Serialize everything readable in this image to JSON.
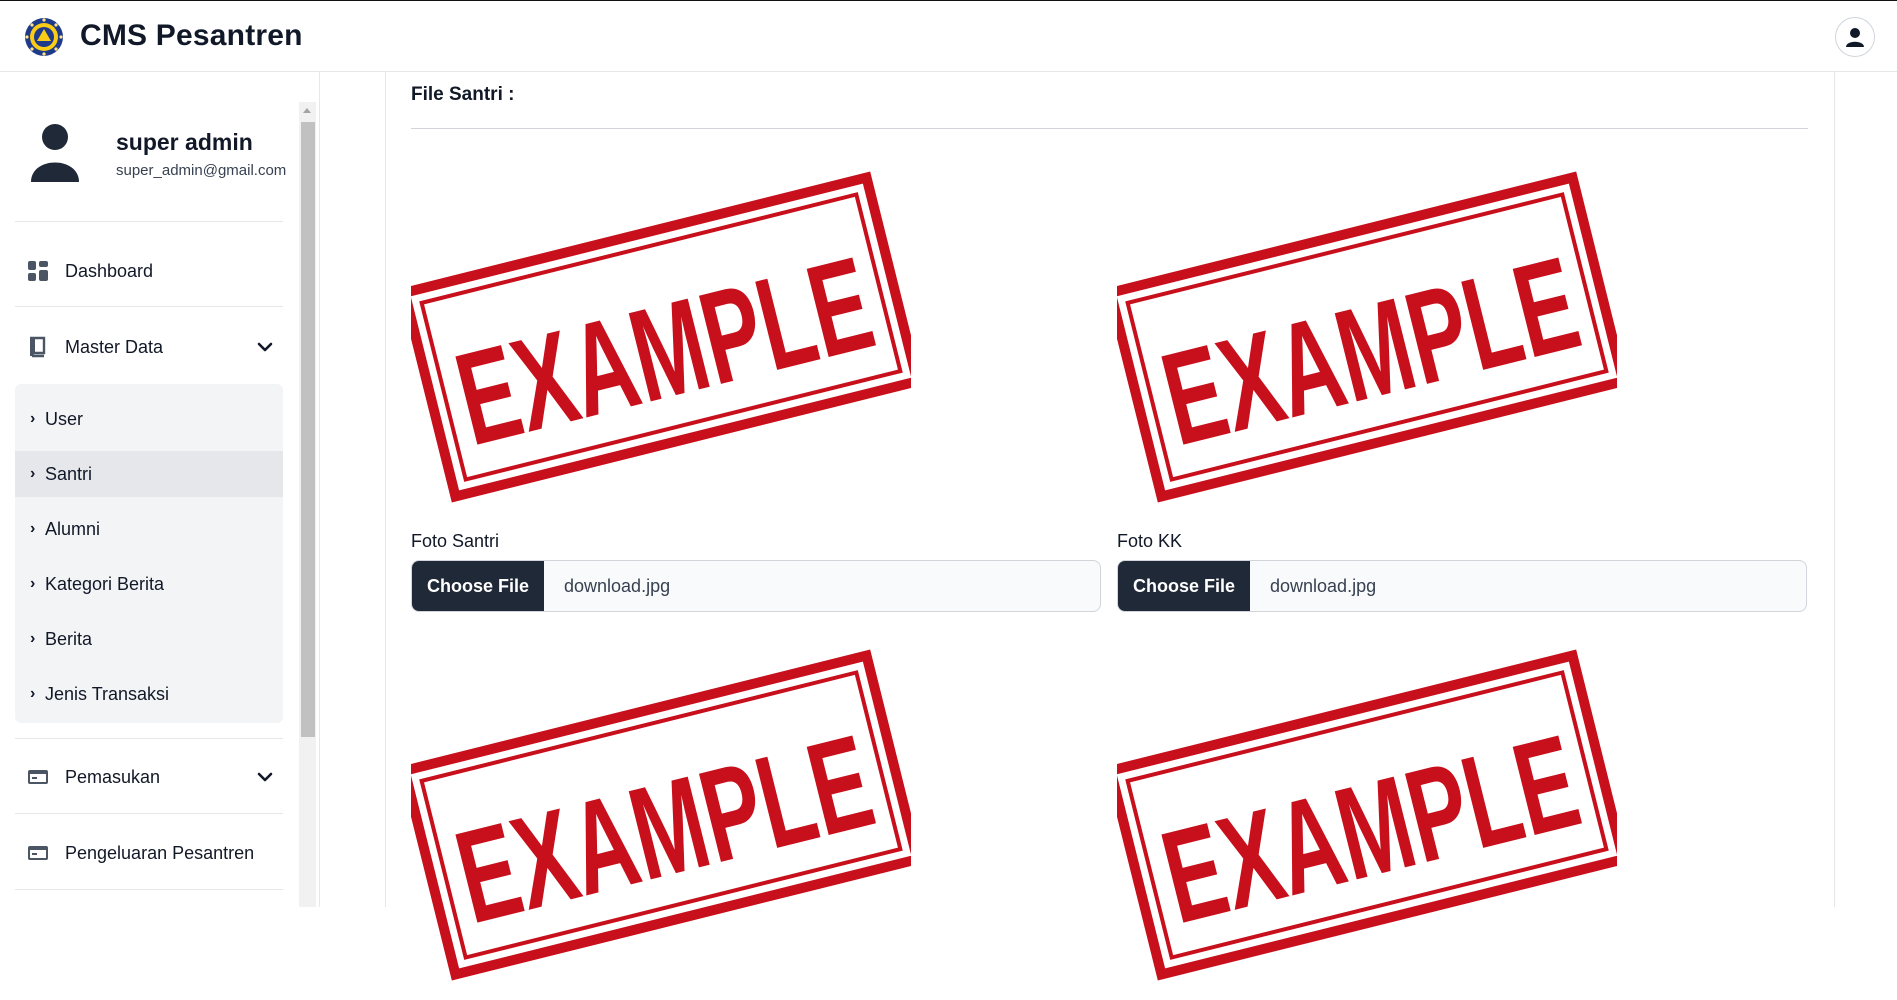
{
  "header": {
    "title": "CMS Pesantren",
    "logo_icon": "pesantren-logo-icon",
    "user_icon": "user-icon"
  },
  "sidebar": {
    "profile": {
      "name": "super admin",
      "email": "super_admin@gmail.com"
    },
    "items": [
      {
        "label": "Dashboard",
        "icon": "dashboard-icon"
      },
      {
        "label": "Master Data",
        "icon": "book-icon",
        "expanded": true
      },
      {
        "label": "Pemasukan",
        "icon": "credit-card-icon"
      },
      {
        "label": "Pengeluaran Pesantren",
        "icon": "credit-card-icon"
      }
    ],
    "master_data_items": [
      "User",
      "Santri",
      "Alumni",
      "Kategori Berita",
      "Berita",
      "Jenis Transaksi"
    ],
    "active_sub_item": "Santri"
  },
  "main": {
    "section_title": "File Santri :",
    "files": [
      {
        "label": "Foto Santri",
        "button": "Choose File",
        "filename": "download.jpg",
        "image_text": "EXAMPLE"
      },
      {
        "label": "Foto KK",
        "button": "Choose File",
        "filename": "download.jpg",
        "image_text": "EXAMPLE"
      },
      {
        "label": "",
        "button": "",
        "filename": "",
        "image_text": "EXAMPLE"
      },
      {
        "label": "",
        "button": "",
        "filename": "",
        "image_text": "EXAMPLE"
      }
    ]
  },
  "colors": {
    "stamp_red": "#c8101c",
    "button_dark": "#1f2937",
    "active_bg": "#e5e7eb",
    "submenu_bg": "#f3f4f6"
  }
}
